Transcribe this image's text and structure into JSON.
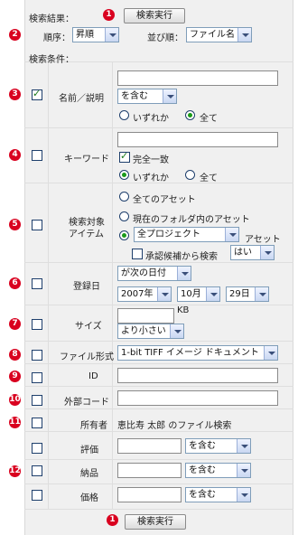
{
  "search_result": {
    "header": "検索結果：",
    "execute_label": "検索実行",
    "order_label": "順序：",
    "order_value": "昇順",
    "sort_label": "並び順：",
    "sort_value": "ファイル名"
  },
  "conditions": {
    "header": "検索条件：",
    "name": {
      "label": "名前／説明",
      "match": "を含む",
      "radio_any": "いずれか",
      "radio_all": "全て"
    },
    "keyword": {
      "label": "キーワード",
      "exact": "完全一致",
      "radio_any": "いずれか",
      "radio_all": "全て"
    },
    "target": {
      "label_line1": "検索対象",
      "label_line2": "アイテム",
      "opt_all_assets": "全てのアセット",
      "opt_current_folder": "現在のフォルダ内のアセット",
      "project_value": "全プロジェクト",
      "project_suffix": "アセット",
      "approval_label": "承認候補から検索",
      "approval_value": "はい"
    },
    "registered": {
      "label": "登録日",
      "date_mode": "が次の日付",
      "year": "2007年",
      "month": "10月",
      "day": "29日"
    },
    "size": {
      "label": "サイズ",
      "unit": "KB",
      "compare": "より小さい"
    },
    "file_format": {
      "label": "ファイル形式",
      "value": "1-bit TIFF イメージ ドキュメント"
    },
    "id": {
      "label": "ID"
    },
    "external_code": {
      "label": "外部コード"
    },
    "owner": {
      "label": "所有者",
      "value": "恵比寿 太郎 のファイル検索"
    },
    "evaluation": {
      "label": "評価",
      "match": "を含む"
    },
    "delivery": {
      "label": "納品",
      "match": "を含む"
    },
    "price": {
      "label": "価格",
      "match": "を含む"
    }
  },
  "markers": [
    "1",
    "2",
    "3",
    "4",
    "5",
    "6",
    "7",
    "8",
    "9",
    "10",
    "11",
    "12",
    "1"
  ],
  "colors": {
    "marker": "#d9001f",
    "panel": "#f0f0f0",
    "radio_dot": "#1a9a1a"
  }
}
